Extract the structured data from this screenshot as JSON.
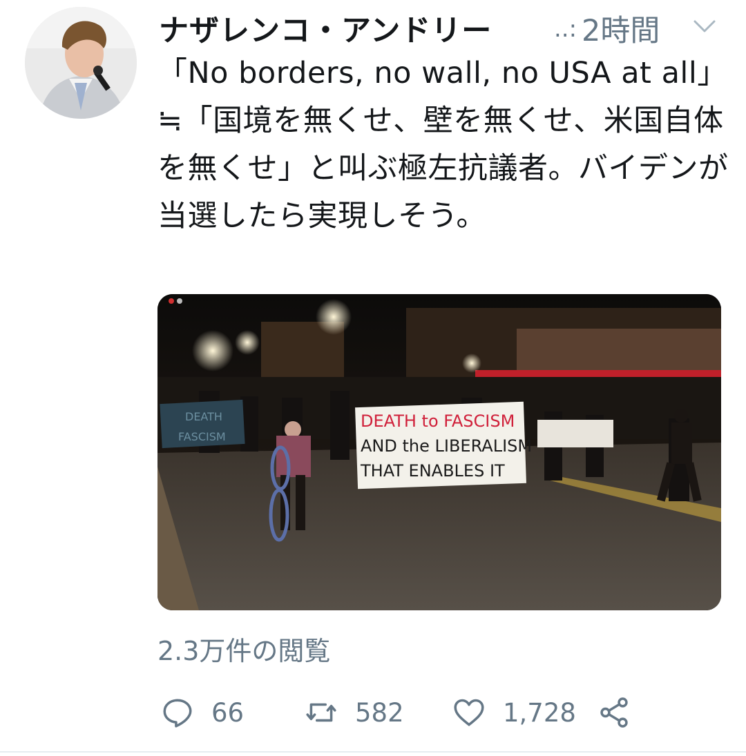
{
  "tweet": {
    "display_name": "ナザレンコ・アンドリー",
    "handle_truncated": "..:",
    "timestamp": "2時間",
    "text": "「No borders, no wall, no USA at all」≒「国境を無くせ、壁を無くせ、米国自体を無くせ」と叫ぶ極左抗議者。バイデンが当選したら実現しそう。",
    "views": "2.3万件の閲覧"
  },
  "media": {
    "banner_main": [
      "DEATH to FASCISM",
      "AND the LIBERALISM",
      "THAT ENABLES IT"
    ],
    "banner_left": [
      "DEATH",
      "FASCISM"
    ]
  },
  "actions": {
    "reply_count": "66",
    "retweet_count": "582",
    "like_count": "1,728"
  },
  "icons": {
    "avatar": "user-avatar",
    "chevron": "chevron-down-icon",
    "reply": "reply-icon",
    "retweet": "retweet-icon",
    "like": "heart-icon",
    "share": "share-icon"
  },
  "colors": {
    "text": "#14171a",
    "secondary": "#657786",
    "divider": "#e6ecf0"
  }
}
